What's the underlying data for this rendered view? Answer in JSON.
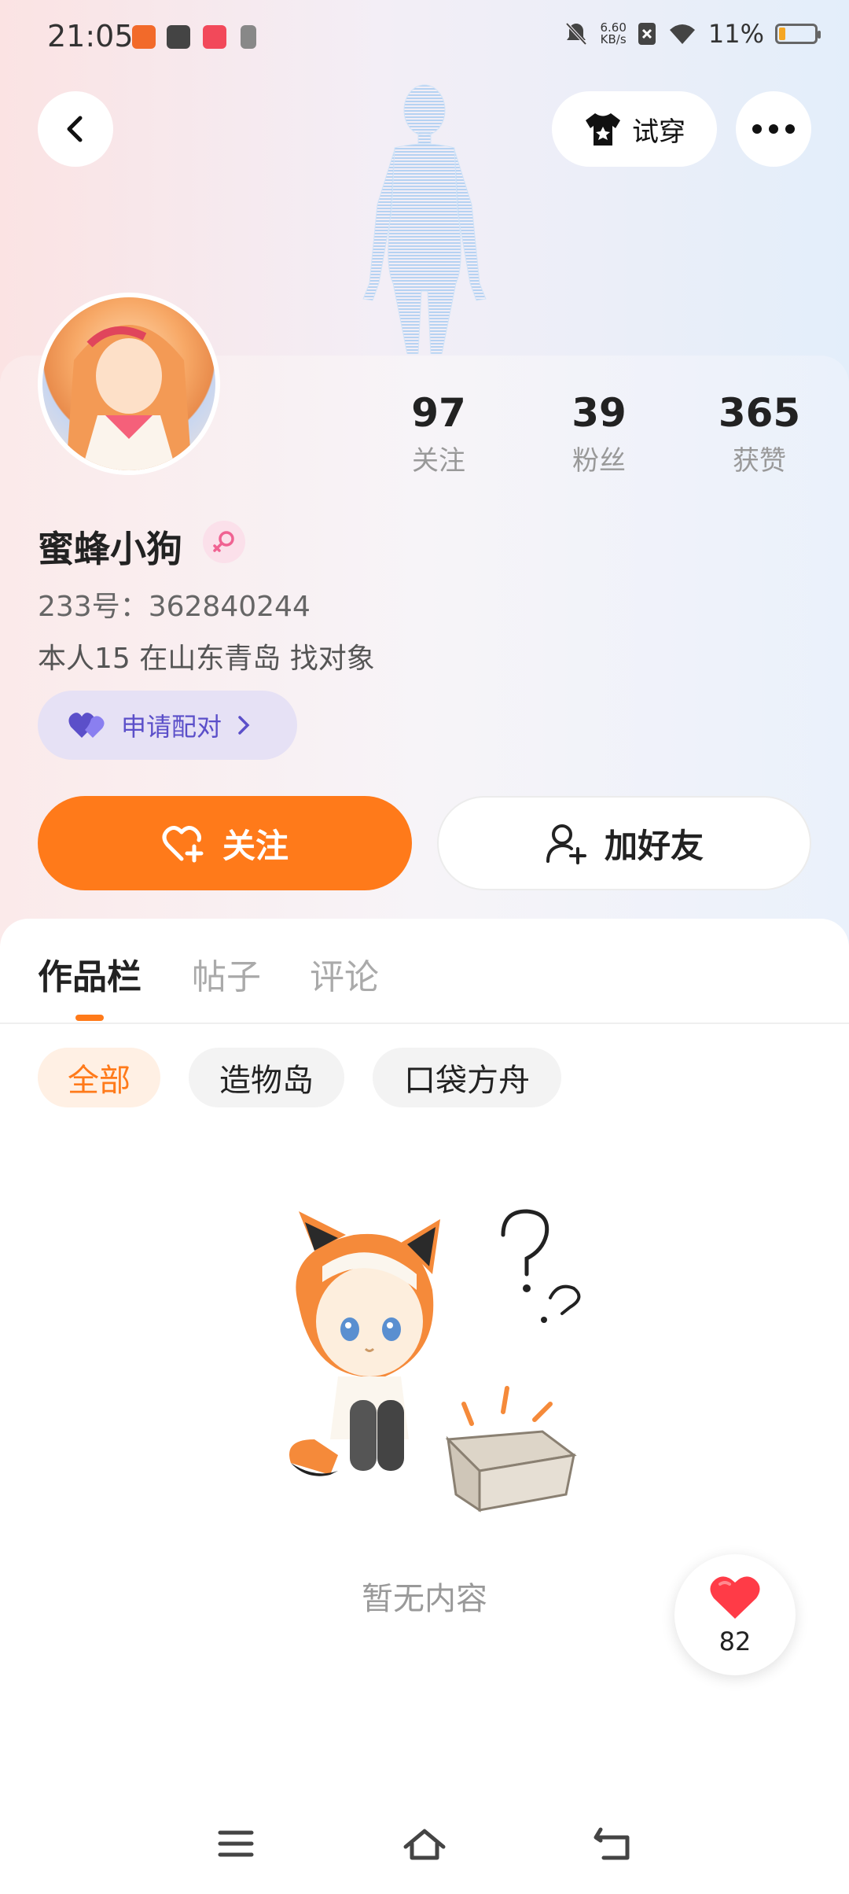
{
  "status_bar": {
    "time": "21:05",
    "net_speed_value": "6.60",
    "net_speed_unit": "KB/s",
    "battery": "11%",
    "battery_level": 0.11
  },
  "header": {
    "try_on_label": "试穿"
  },
  "profile": {
    "stats": [
      {
        "value": "97",
        "label": "关注"
      },
      {
        "value": "39",
        "label": "粉丝"
      },
      {
        "value": "365",
        "label": "获赞"
      }
    ],
    "username": "蜜蜂小狗",
    "uid": "233号：362840244",
    "bio": "本人15    在山东青岛  找对象",
    "match_label": "申请配对",
    "follow_label": "关注",
    "add_friend_label": "加好友"
  },
  "tabs": [
    {
      "label": "作品栏",
      "active": true
    },
    {
      "label": "帖子",
      "active": false
    },
    {
      "label": "评论",
      "active": false
    }
  ],
  "filters": [
    {
      "label": "全部",
      "active": true
    },
    {
      "label": "造物岛",
      "active": false
    },
    {
      "label": "口袋方舟",
      "active": false
    }
  ],
  "empty_state": {
    "text": "暂无内容"
  },
  "like_fab": {
    "count": "82"
  },
  "colors": {
    "accent": "#ff7a1a",
    "match_purple": "#5b4fc9",
    "heart_red": "#ff3b47"
  }
}
